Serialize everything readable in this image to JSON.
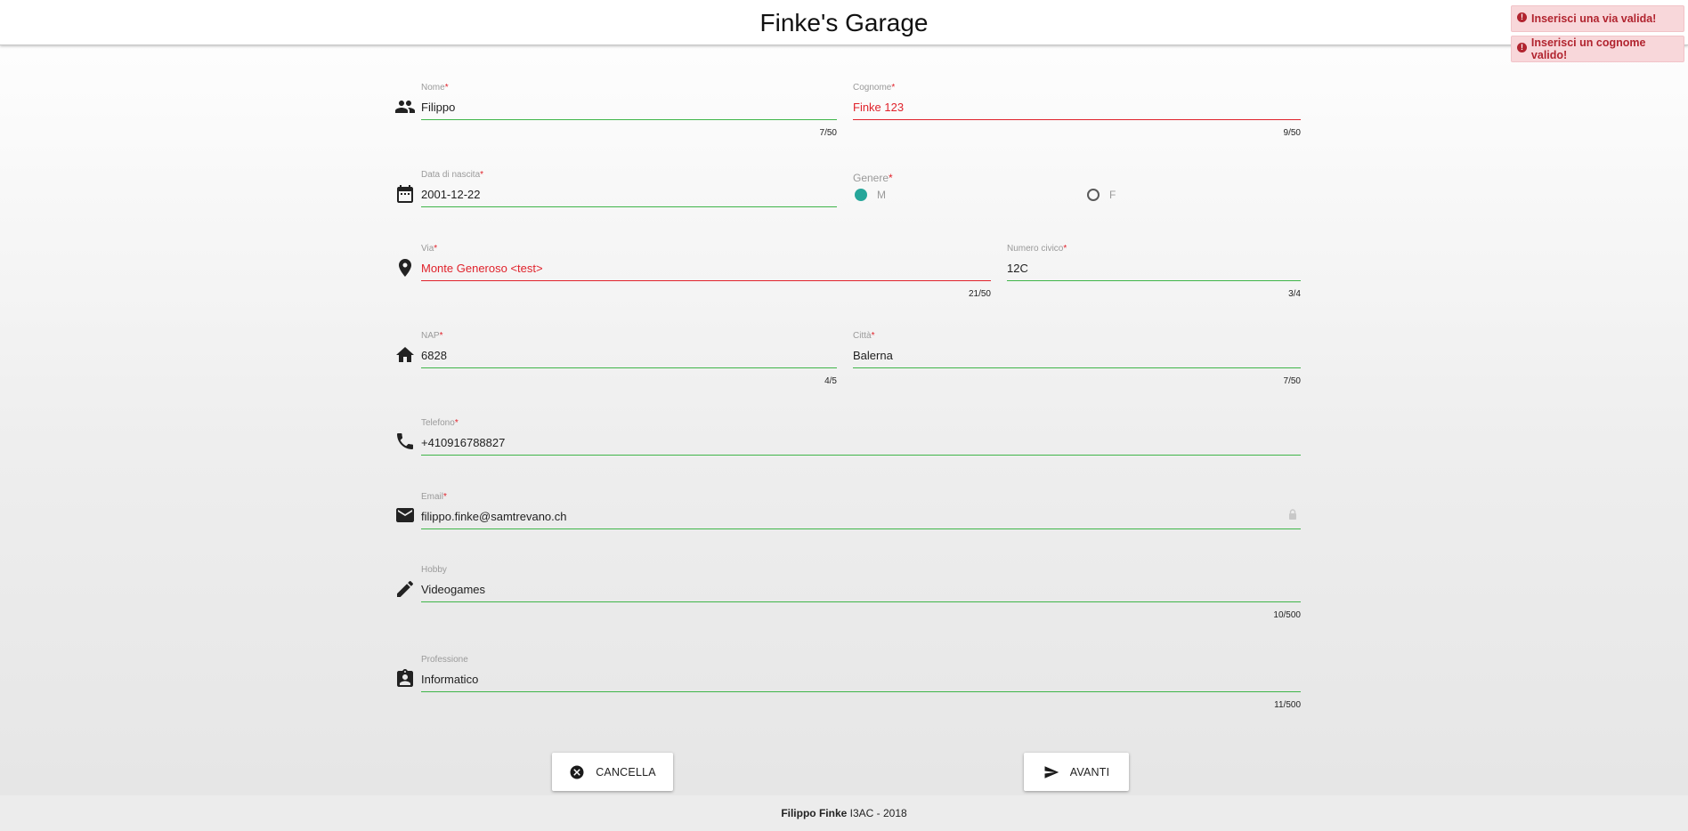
{
  "header": {
    "title": "Finke's Garage"
  },
  "toasts": [
    {
      "text": "Inserisci una via valida!"
    },
    {
      "text": "Inserisci un cognome valido!"
    }
  ],
  "form": {
    "required_mark": "*",
    "nome": {
      "label": "Nome",
      "value": "Filippo",
      "counter": "7/50"
    },
    "cognome": {
      "label": "Cognome",
      "value": "Finke 123",
      "counter": "9/50"
    },
    "data_nascita": {
      "label": "Data di nascita",
      "value": "2001-12-22"
    },
    "genere": {
      "label": "Genere",
      "options": [
        "M",
        "F"
      ],
      "selected": "M"
    },
    "via": {
      "label": "Via",
      "value": "Monte Generoso <test>",
      "counter": "21/50"
    },
    "numero_civico": {
      "label": "Numero civico",
      "value": "12C",
      "counter": "3/4"
    },
    "nap": {
      "label": "NAP",
      "value": "6828",
      "counter": "4/5"
    },
    "citta": {
      "label": "Città",
      "value": "Balerna",
      "counter": "7/50"
    },
    "telefono": {
      "label": "Telefono",
      "value": "+410916788827"
    },
    "email": {
      "label": "Email",
      "value": "filippo.finke@samtrevano.ch"
    },
    "hobby": {
      "label": "Hobby",
      "value": "Videogames",
      "counter": "10/500"
    },
    "professione": {
      "label": "Professione",
      "value": "Informatico",
      "counter": "11/500"
    }
  },
  "buttons": {
    "cancel": "CANCELLA",
    "next": "AVANTI"
  },
  "footer": {
    "author": "Filippo Finke",
    "rest": " I3AC - 2018"
  },
  "colors": {
    "valid": "#3fb549",
    "invalid": "#e0222b",
    "radio_on": "#26a69a",
    "toast_bg": "#f8d7da",
    "toast_text": "#b1242f"
  }
}
